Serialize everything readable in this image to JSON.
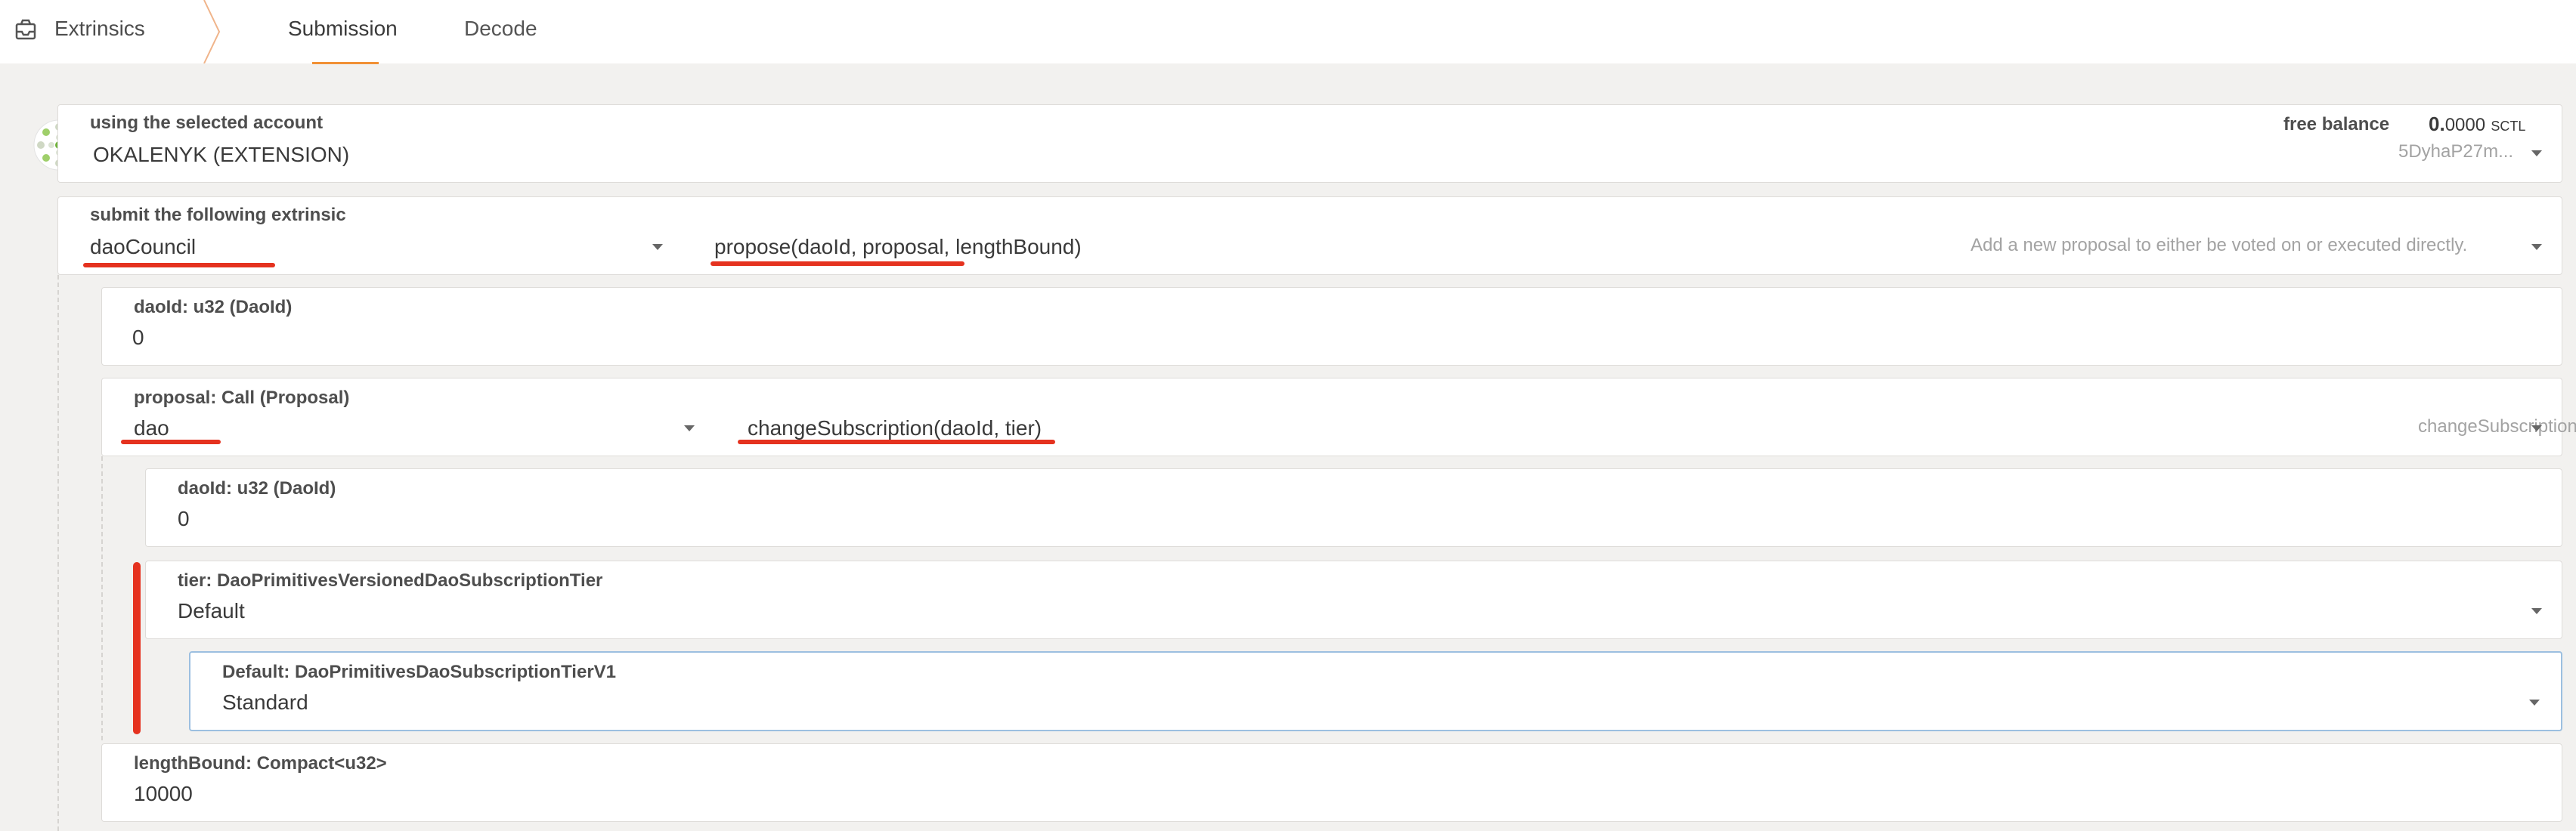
{
  "nav": {
    "section_title": "Extrinsics",
    "tabs": [
      {
        "label": "Submission",
        "active": true
      },
      {
        "label": "Decode",
        "active": false
      }
    ]
  },
  "account": {
    "label": "using the selected account",
    "name": "OKALENYK (EXTENSION)",
    "balance_label": "free balance",
    "balance_int": "0.",
    "balance_dec": "0000",
    "balance_unit": "SCTL",
    "address": "5DyhaP27m..."
  },
  "extrinsic": {
    "label": "submit the following extrinsic",
    "pallet": "daoCouncil",
    "method": "propose(daoId, proposal, lengthBound)",
    "description": "Add a new proposal to either be voted on or executed directly."
  },
  "params": {
    "dao_id": {
      "label": "daoId: u32 (DaoId)",
      "value": "0"
    },
    "proposal": {
      "label": "proposal: Call (Proposal)",
      "pallet": "dao",
      "method": "changeSubscription(daoId, tier)",
      "description": "changeSubscription"
    },
    "inner_dao_id": {
      "label": "daoId: u32 (DaoId)",
      "value": "0"
    },
    "tier": {
      "label": "tier: DaoPrimitivesVersionedDaoSubscriptionTier",
      "value": "Default"
    },
    "tier_default": {
      "label": "Default: DaoPrimitivesDaoSubscriptionTierV1",
      "value": "Standard"
    },
    "length_bound": {
      "label": "lengthBound: Compact<u32>",
      "value": "10000"
    }
  },
  "colors": {
    "accent": "#f19135",
    "annotation": "#e5321f",
    "focus_border": "#9cbfe0"
  }
}
